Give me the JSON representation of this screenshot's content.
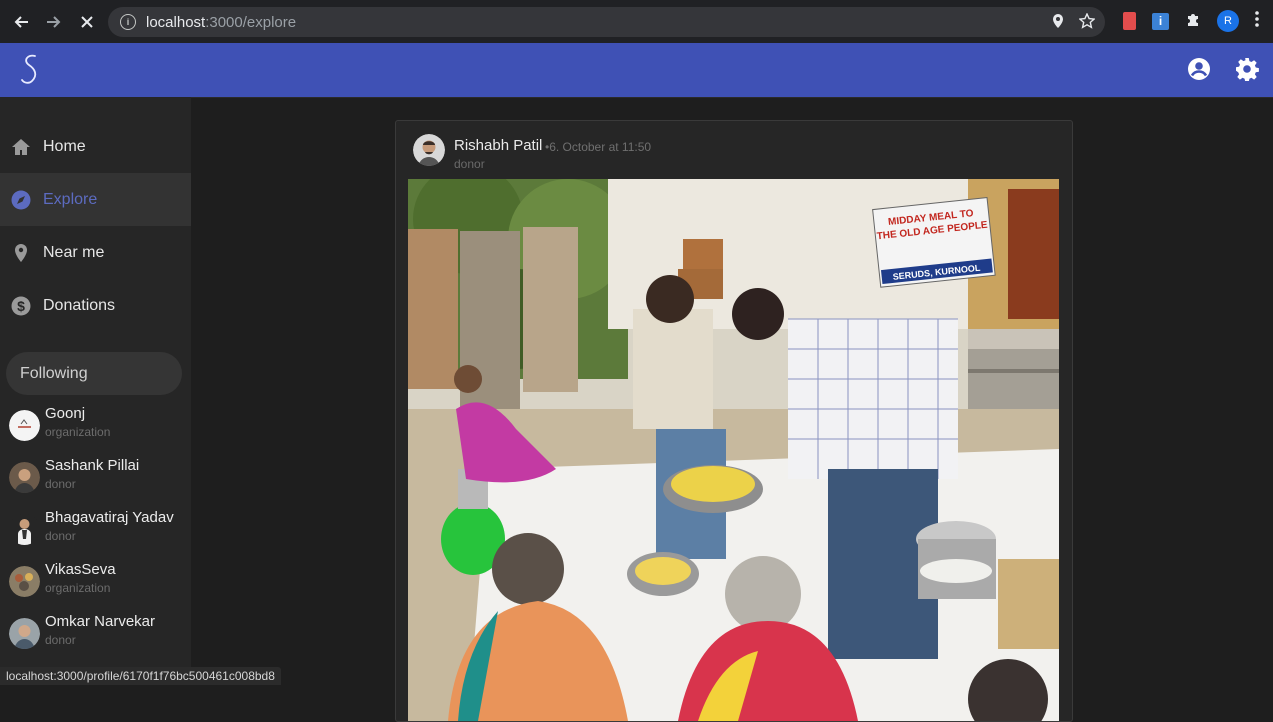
{
  "browser": {
    "url_host": "localhost",
    "url_path": ":3000/explore",
    "profile_initial": "R",
    "status_url": "localhost:3000/profile/6170f1f76bc500461c008bd8"
  },
  "sidebar": {
    "items": [
      {
        "label": "Home",
        "icon": "home-icon"
      },
      {
        "label": "Explore",
        "icon": "compass-icon"
      },
      {
        "label": "Near me",
        "icon": "location-pin-icon"
      },
      {
        "label": "Donations",
        "icon": "dollar-icon"
      }
    ],
    "following_label": "Following",
    "following": [
      {
        "name": "Goonj",
        "role": "organization"
      },
      {
        "name": "Sashank Pillai",
        "role": "donor"
      },
      {
        "name": "Bhagavatiraj Yadav",
        "role": "donor"
      },
      {
        "name": "VikasSeva",
        "role": "organization"
      },
      {
        "name": "Omkar Narvekar",
        "role": "donor"
      }
    ]
  },
  "post": {
    "author": "Rishabh Patil",
    "time": "•6. October at 11:50",
    "role": "donor",
    "photo_sign": {
      "line1": "MIDDAY MEAL TO",
      "line2": "THE OLD AGE PEOPLE",
      "line3": "SERUDS, KURNOOL"
    }
  },
  "colors": {
    "appbar": "#3f51b5",
    "accent": "#5c6bc0",
    "background": "#1e1e1e",
    "sidebar": "#262626"
  }
}
